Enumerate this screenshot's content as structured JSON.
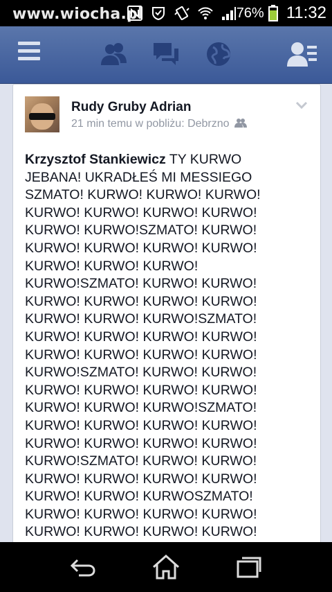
{
  "watermark": "www.wiocha.pl",
  "status": {
    "battery": "76%",
    "time": "11:32",
    "icons": [
      "nfc-icon",
      "shield-icon",
      "vibrate-icon",
      "wifi-icon",
      "signal-icon",
      "battery-icon"
    ]
  },
  "nav": {
    "items": [
      "menu-icon",
      "friends-icon",
      "messages-icon",
      "notifications-globe-icon",
      "friend-requests-icon"
    ]
  },
  "post": {
    "author": "Rudy Gruby Adrian",
    "meta": "21 min temu w pobliżu: Debrzno",
    "tagged": "Krzysztof Stankiewicz",
    "lines": [
      "TY KURWO",
      "JEBANA! UKRADŁEŚ MI MESSIEGO",
      "SZMATO! KURWO! KURWO! KURWO!",
      "KURWO! KURWO! KURWO! KURWO!",
      "KURWO! KURWO!SZMATO! KURWO!",
      "KURWO! KURWO! KURWO! KURWO!",
      "KURWO! KURWO! KURWO!",
      "KURWO!SZMATO! KURWO! KURWO!",
      "KURWO! KURWO! KURWO! KURWO!",
      "KURWO! KURWO! KURWO!SZMATO!",
      "KURWO! KURWO! KURWO! KURWO!",
      "KURWO! KURWO! KURWO! KURWO!",
      "KURWO!SZMATO! KURWO! KURWO!",
      "KURWO! KURWO! KURWO! KURWO!",
      "KURWO! KURWO! KURWO!SZMATO!",
      "KURWO! KURWO! KURWO! KURWO!",
      "KURWO! KURWO! KURWO! KURWO!",
      "KURWO!SZMATO! KURWO! KURWO!",
      "KURWO! KURWO! KURWO! KURWO!",
      "KURWO! KURWO! KURWOSZMATO!",
      "KURWO! KURWO! KURWO! KURWO!",
      "KURWO! KURWO! KURWO! KURWO!"
    ]
  },
  "softkeys": [
    "back-icon",
    "home-icon",
    "recent-apps-icon"
  ],
  "colors": {
    "fb_blue": "#3b5998",
    "meta_gray": "#9197a3"
  }
}
